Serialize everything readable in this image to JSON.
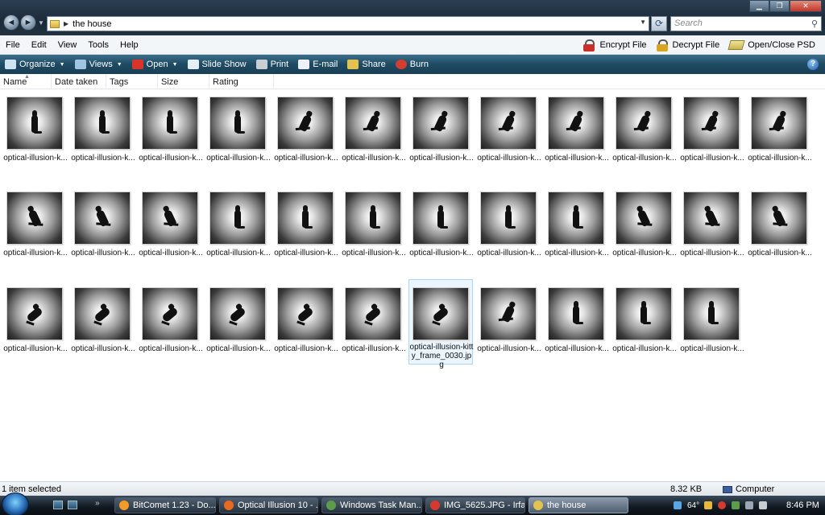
{
  "window": {
    "address": "the house",
    "search_placeholder": "Search",
    "back_glyph": "◄",
    "forward_glyph": "►"
  },
  "menu": {
    "items": [
      "File",
      "Edit",
      "View",
      "Tools",
      "Help"
    ],
    "encrypt": "Encrypt File",
    "decrypt": "Decrypt File",
    "psd": "Open/Close PSD"
  },
  "commands": {
    "organize": "Organize",
    "views": "Views",
    "open": "Open",
    "slideshow": "Slide Show",
    "print": "Print",
    "email": "E-mail",
    "share": "Share",
    "burn": "Burn",
    "help": "?"
  },
  "columns": [
    "Name",
    "Date taken",
    "Tags",
    "Size",
    "Rating"
  ],
  "files": {
    "truncated_label": "optical-illusion-k...",
    "selected_label": "optical-illusion-kitty_frame_0030.jpg",
    "rows": [
      [
        "stand",
        "stand",
        "stand",
        "stand",
        "leanr",
        "leanr",
        "leanr",
        "leanr",
        "leanr",
        "leanr",
        "leanr",
        "leanr"
      ],
      [
        "lean",
        "lean",
        "lean",
        "stand",
        "stand",
        "stand",
        "stand",
        "stand",
        "stand",
        "lean",
        "lean",
        "lean"
      ],
      [
        "leap",
        "leap",
        "leap",
        "leap",
        "leap",
        "leap",
        "leap",
        "leanr",
        "stand",
        "stand",
        "stand"
      ]
    ],
    "selected_row": 2,
    "selected_col": 6
  },
  "status": {
    "selection": "1 item selected",
    "size": "8.32 KB",
    "location": "Computer"
  },
  "taskbar": {
    "buttons": [
      {
        "label": "BitComet 1.23 - Do...",
        "color": "#f39a2b"
      },
      {
        "label": "Optical Illusion 10 - ...",
        "color": "#e86a1e"
      },
      {
        "label": "Windows Task Man...",
        "color": "#5c9c4a"
      },
      {
        "label": "IMG_5625.JPG - Irfa...",
        "color": "#d63a2e"
      },
      {
        "label": "the house",
        "color": "#e3c24f"
      }
    ],
    "tray_temp": "64°",
    "clock": "8:46 PM"
  }
}
